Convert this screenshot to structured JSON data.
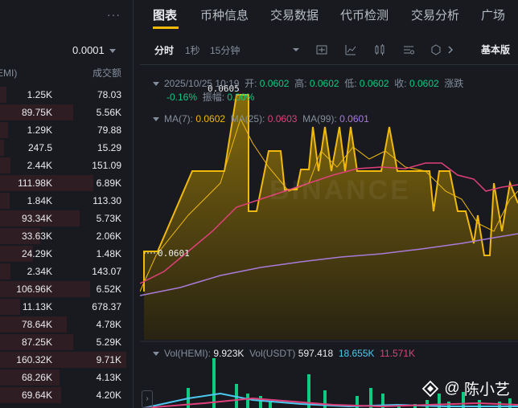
{
  "orderbook": {
    "more_label": "···",
    "precision": "0.0001",
    "col_amount": "量 (HEMI)",
    "col_total": "成交额",
    "rows": [
      {
        "amount": "1.25K",
        "total": "78.03",
        "depth": 0.05
      },
      {
        "amount": "89.75K",
        "total": "5.56K",
        "depth": 0.55
      },
      {
        "amount": "1.29K",
        "total": "79.88",
        "depth": 0.06
      },
      {
        "amount": "247.5",
        "total": "15.29",
        "depth": 0.03
      },
      {
        "amount": "2.44K",
        "total": "151.09",
        "depth": 0.08
      },
      {
        "amount": "111.98K",
        "total": "6.89K",
        "depth": 0.7
      },
      {
        "amount": "1.84K",
        "total": "113.30",
        "depth": 0.07
      },
      {
        "amount": "93.34K",
        "total": "5.73K",
        "depth": 0.6
      },
      {
        "amount": "33.63K",
        "total": "2.06K",
        "depth": 0.3
      },
      {
        "amount": "24.29K",
        "total": "1.48K",
        "depth": 0.25
      },
      {
        "amount": "2.34K",
        "total": "143.07",
        "depth": 0.08
      },
      {
        "amount": "106.96K",
        "total": "6.52K",
        "depth": 0.68
      },
      {
        "amount": "11.13K",
        "total": "678.37",
        "depth": 0.15
      },
      {
        "amount": "78.64K",
        "total": "4.78K",
        "depth": 0.5
      },
      {
        "amount": "87.25K",
        "total": "5.29K",
        "depth": 0.55
      },
      {
        "amount": "160.32K",
        "total": "9.71K",
        "depth": 0.95
      },
      {
        "amount": "68.26K",
        "total": "4.13K",
        "depth": 0.45
      },
      {
        "amount": "69.64K",
        "total": "4.20K",
        "depth": 0.46
      }
    ]
  },
  "nav": {
    "tabs": [
      "图表",
      "币种信息",
      "交易数据",
      "代币检测",
      "交易分析",
      "广场"
    ]
  },
  "toolbar": {
    "intervals": [
      "分时",
      "1秒",
      "15分钟"
    ],
    "basic_label": "基本版"
  },
  "ohlc": {
    "date": "2025/10/25 10:19",
    "open_label": "开:",
    "open": "0.0602",
    "high_label": "高:",
    "high": "0.0602",
    "low_label": "低:",
    "low": "0.0602",
    "close_label": "收:",
    "close": "0.0602",
    "change_label": "涨跌",
    "change_pct": "-0.16%",
    "amplitude_label": "振幅:",
    "amplitude": "0.00%"
  },
  "ma": {
    "ma7_label": "MA(7):",
    "ma7": "0.0602",
    "ma25_label": "MA(25):",
    "ma25": "0.0603",
    "ma99_label": "MA(99):",
    "ma99": "0.0601"
  },
  "volume": {
    "hemi_label": "Vol(HEMI):",
    "hemi": "9.923K",
    "usdt_label": "Vol(USDT)",
    "usdt": "597.418",
    "v2": "18.655K",
    "v3": "11.571K"
  },
  "chart": {
    "price_marker": "0.0601",
    "peak_marker": "0.0605",
    "watermark": "BINANCE"
  },
  "author": "陈小艺",
  "colors": {
    "accent": "#f0b90b",
    "up": "#0ecb81",
    "down": "#f6465d",
    "ma25": "#e0407a",
    "ma99": "#a97bd9"
  }
}
